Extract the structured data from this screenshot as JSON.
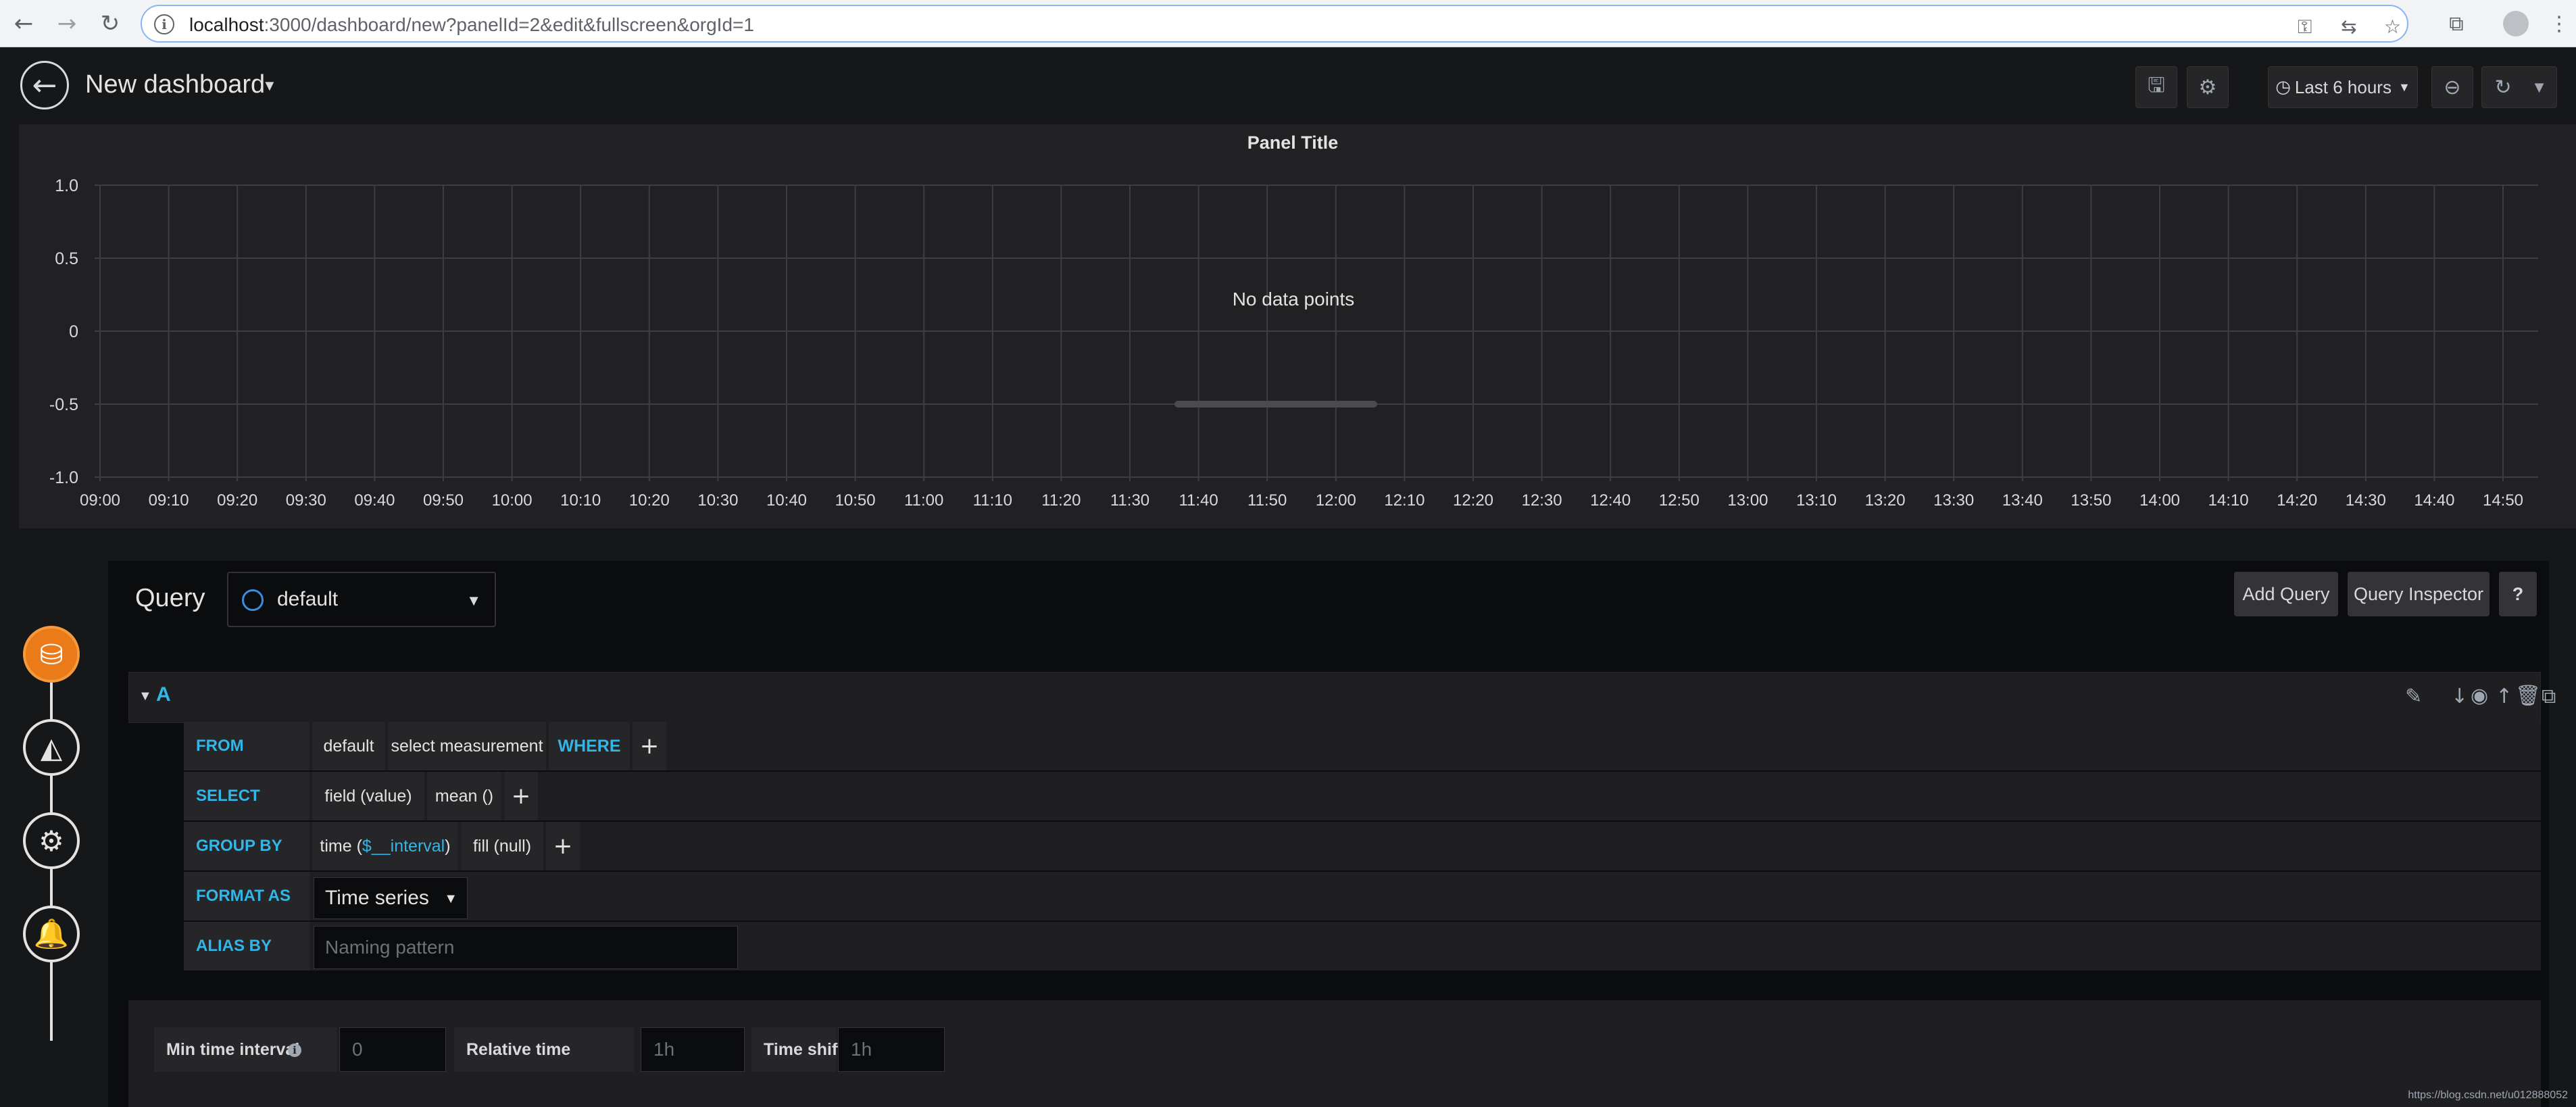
{
  "browser": {
    "url_host": "localhost",
    "url_path": ":3000/dashboard/new?panelId=2&edit&fullscreen&orgId=1",
    "back_icon": "arrow-left-icon",
    "forward_icon": "arrow-right-icon",
    "reload_icon": "reload-icon"
  },
  "header": {
    "title": "New dashboard",
    "time_range": "Last 6 hours"
  },
  "panel": {
    "title": "Panel Title",
    "empty_message": "No data points"
  },
  "chart_data": {
    "type": "line",
    "title": "Panel Title",
    "series": [],
    "y_ticks": [
      "1.0",
      "0.5",
      "0",
      "-0.5",
      "-1.0"
    ],
    "ylim": [
      -1.0,
      1.0
    ],
    "x_ticks": [
      "09:00",
      "09:10",
      "09:20",
      "09:30",
      "09:40",
      "09:50",
      "10:00",
      "10:10",
      "10:20",
      "10:30",
      "10:40",
      "10:50",
      "11:00",
      "11:10",
      "11:20",
      "11:30",
      "11:40",
      "11:50",
      "12:00",
      "12:10",
      "12:20",
      "12:30",
      "12:40",
      "12:50",
      "13:00",
      "13:10",
      "13:20",
      "13:30",
      "13:40",
      "13:50",
      "14:00",
      "14:10",
      "14:20",
      "14:30",
      "14:40",
      "14:50"
    ],
    "grid": true,
    "annotation": "No data points"
  },
  "editor": {
    "query_label": "Query",
    "datasource": "default",
    "add_query": "Add Query",
    "query_inspector": "Query Inspector",
    "help": "?",
    "query_letter": "A",
    "rows": {
      "from": {
        "key": "FROM",
        "db": "default",
        "measurement": "select measurement",
        "where": "WHERE",
        "plus": "+"
      },
      "select": {
        "key": "SELECT",
        "field": "field (value)",
        "fn": "mean ()",
        "plus": "+"
      },
      "group_by": {
        "key": "GROUP BY",
        "time_prefix": "time (",
        "time_var": "$__interval",
        "time_suffix": ")",
        "fill": "fill (null)",
        "plus": "+"
      },
      "format_as": {
        "key": "FORMAT AS",
        "value": "Time series"
      },
      "alias_by": {
        "key": "ALIAS BY",
        "placeholder": "Naming pattern"
      }
    },
    "options": {
      "min_interval_label": "Min time interval",
      "min_interval_placeholder": "0",
      "relative_time_label": "Relative time",
      "relative_time_placeholder": "1h",
      "time_shift_label": "Time shift",
      "time_shift_placeholder": "1h"
    }
  },
  "watermark": "https://blog.csdn.net/u012888052"
}
